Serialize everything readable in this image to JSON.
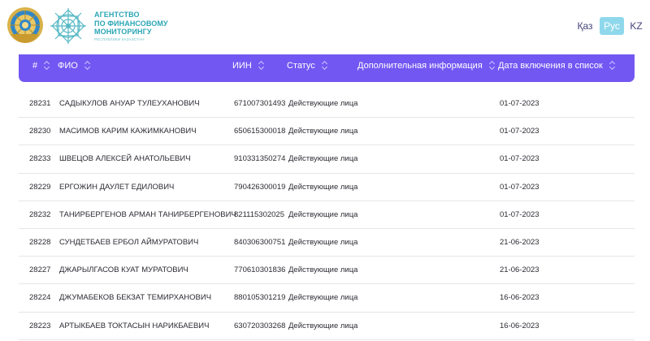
{
  "header": {
    "agency_line1": "АГЕНТСТВО",
    "agency_line2": "ПО ФИНАНСОВОМУ",
    "agency_line3": "МОНИТОРИНГУ",
    "agency_sub": "РЕСПУБЛИКИ КАЗАХСТАН",
    "brand_color": "#2aa6b4",
    "emblem_icon": "state-emblem-icon",
    "logo_icon": "agency-logo-icon"
  },
  "languages": [
    {
      "label": "Қаз",
      "active": false
    },
    {
      "label": "Рус",
      "active": true
    },
    {
      "label": "KZ",
      "active": false
    }
  ],
  "table": {
    "header_color": "#7357f2",
    "columns": {
      "num": "#",
      "fio": "ФИО",
      "iin": "ИИН",
      "status": "Статус",
      "info": "Дополнительная информация",
      "date": "Дата включения в список"
    },
    "rows": [
      {
        "num": "28231",
        "fio": "САДЫКУЛОВ АНУАР ТУЛЕУХАНОВИЧ",
        "iin": "671007301493",
        "status": "Действующие лица",
        "info": "",
        "date": "01-07-2023"
      },
      {
        "num": "28230",
        "fio": "МАСИМОВ КАРИМ КАЖИМКАНОВИЧ",
        "iin": "650615300018",
        "status": "Действующие лица",
        "info": "",
        "date": "01-07-2023"
      },
      {
        "num": "28233",
        "fio": "ШВЕЦОВ АЛЕКСЕЙ АНАТОЛЬЕВИЧ",
        "iin": "910331350274",
        "status": "Действующие лица",
        "info": "",
        "date": "01-07-2023"
      },
      {
        "num": "28229",
        "fio": "ЕРГОЖИН ДАУЛЕТ ЕДИЛОВИЧ",
        "iin": "790426300019",
        "status": "Действующие лица",
        "info": "",
        "date": "01-07-2023"
      },
      {
        "num": "28232",
        "fio": "ТАНИРБЕРГЕНОВ АРМАН ТАНИРБЕРГЕНОВИЧ",
        "iin": "821115302025",
        "status": "Действующие лица",
        "info": "",
        "date": "01-07-2023"
      },
      {
        "num": "28228",
        "fio": "СУНДЕТБАЕВ ЕРБОЛ АЙМУРАТОВИЧ",
        "iin": "840306300751",
        "status": "Действующие лица",
        "info": "",
        "date": "21-06-2023"
      },
      {
        "num": "28227",
        "fio": "ДЖАРЫЛГАСОВ КУАТ МУРАТОВИЧ",
        "iin": "770610301836",
        "status": "Действующие лица",
        "info": "",
        "date": "21-06-2023"
      },
      {
        "num": "28224",
        "fio": "ДЖУМАБЕКОВ БЕКЗАТ ТЕМИРХАНОВИЧ",
        "iin": "880105301219",
        "status": "Действующие лица",
        "info": "",
        "date": "16-06-2023"
      },
      {
        "num": "28223",
        "fio": "АРТЫКБАЕВ ТОКТАСЫН НАРИКБАЕВИЧ",
        "iin": "630720303268",
        "status": "Действующие лица",
        "info": "",
        "date": "16-06-2023"
      }
    ]
  }
}
